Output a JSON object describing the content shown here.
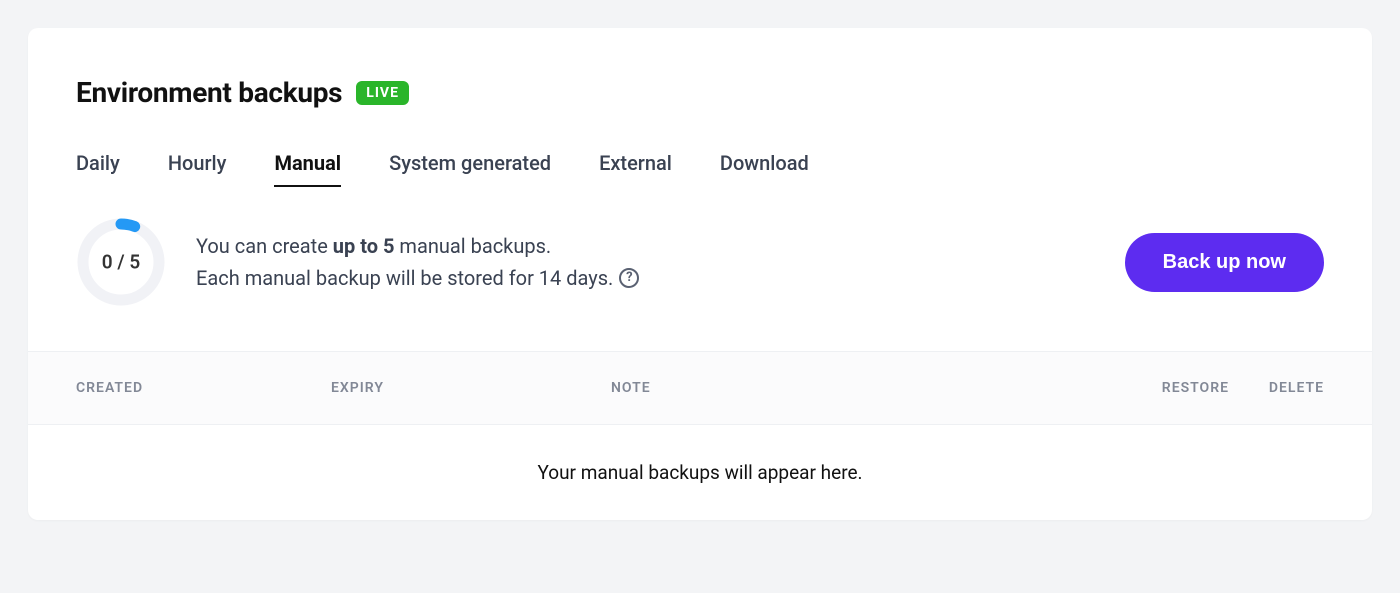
{
  "header": {
    "title": "Environment backups",
    "badge": "LIVE"
  },
  "tabs": [
    {
      "label": "Daily",
      "active": false
    },
    {
      "label": "Hourly",
      "active": false
    },
    {
      "label": "Manual",
      "active": true
    },
    {
      "label": "System generated",
      "active": false
    },
    {
      "label": "External",
      "active": false
    },
    {
      "label": "Download",
      "active": false
    }
  ],
  "gauge": {
    "used": 0,
    "total": 5,
    "label": "0 / 5"
  },
  "info": {
    "line1_pre": "You can create ",
    "line1_bold": "up to 5",
    "line1_post": " manual backups.",
    "line2": "Each manual backup will be stored for 14 days."
  },
  "action": {
    "backup_button": "Back up now"
  },
  "columns": {
    "created": "CREATED",
    "expiry": "EXPIRY",
    "note": "NOTE",
    "restore": "RESTORE",
    "delete": "DELETE"
  },
  "empty_state": "Your manual backups will appear here."
}
